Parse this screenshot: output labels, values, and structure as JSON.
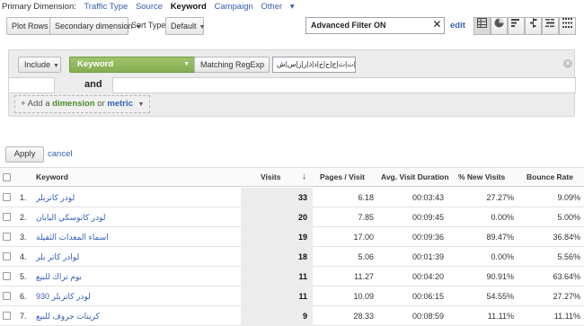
{
  "dimension_bar": {
    "label": "Primary Dimension:",
    "items": [
      {
        "label": "Traffic Type",
        "active": false
      },
      {
        "label": "Source",
        "active": false
      },
      {
        "label": "Keyword",
        "active": true
      },
      {
        "label": "Campaign",
        "active": false
      },
      {
        "label": "Other",
        "active": false
      }
    ],
    "other_caret": "▾"
  },
  "toolbar": {
    "plot_rows": "Plot Rows",
    "secondary_dimension": "Secondary dimension",
    "sort_type_label": "Sort Type:",
    "sort_type_value": "Default",
    "filter_value": "Advanced Filter ON",
    "filter_clear": "✕",
    "edit": "edit",
    "view_icons": [
      "table-view-icon",
      "pie-view-icon",
      "bar-view-icon",
      "comparison-view-icon",
      "term-cloud-icon",
      "pivot-view-icon"
    ]
  },
  "filter_panel": {
    "include": "Include",
    "dimension": "Keyword",
    "match_type": "Matching RegExp",
    "regex_value": "اب|ت|ث|ج|ح|خ|د|ذ|ر|ز|س|ش",
    "and_label": "and",
    "add_prefix": "+ Add a",
    "add_dimension": "dimension",
    "add_or": "or",
    "add_metric": "metric"
  },
  "apply": "Apply",
  "cancel": "cancel",
  "table": {
    "headers": {
      "keyword": "Keyword",
      "visits": "Visits",
      "sort_arrow": "↓",
      "pages_visit": "Pages / Visit",
      "avg_duration": "Avg. Visit Duration",
      "new_visits": "% New Visits",
      "bounce_rate": "Bounce Rate"
    },
    "rows": [
      {
        "index": "1.",
        "keyword": "لودر كاتربلر",
        "visits": "33",
        "pages": "6.18",
        "duration": "00:03:43",
        "new": "27.27%",
        "bounce": "9.09%"
      },
      {
        "index": "2.",
        "keyword": "لودر كاتوسكي اليابان",
        "visits": "20",
        "pages": "7.85",
        "duration": "00:09:45",
        "new": "0.00%",
        "bounce": "5.00%"
      },
      {
        "index": "3.",
        "keyword": "اسماء المعدات الثقيلة",
        "visits": "19",
        "pages": "17.00",
        "duration": "00:09:36",
        "new": "89.47%",
        "bounce": "36.84%"
      },
      {
        "index": "4.",
        "keyword": "لوادر كاتر بلر",
        "visits": "18",
        "pages": "5.06",
        "duration": "00:01:39",
        "new": "0.00%",
        "bounce": "5.56%"
      },
      {
        "index": "5.",
        "keyword": "بوم تراك للبيع",
        "visits": "11",
        "pages": "11.27",
        "duration": "00:04:20",
        "new": "90.91%",
        "bounce": "63.64%"
      },
      {
        "index": "6.",
        "keyword": "لودر كاتربلر 930",
        "visits": "11",
        "pages": "10.09",
        "duration": "00:06:15",
        "new": "54.55%",
        "bounce": "27.27%"
      },
      {
        "index": "7.",
        "keyword": "كرينات جروف للبيع",
        "visits": "9",
        "pages": "28.33",
        "duration": "00:08:59",
        "new": "11.11%",
        "bounce": "11.11%"
      }
    ]
  }
}
